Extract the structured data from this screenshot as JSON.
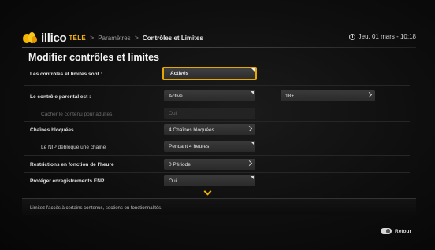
{
  "header": {
    "brand": "illico",
    "brand_sub": "TÉLÉ",
    "breadcrumb": [
      "Paramètres",
      "Contrôles et Limites"
    ],
    "separator": ">",
    "datetime": "Jeu. 01 mars - 10:18"
  },
  "page_title": "Modifier contrôles et limites",
  "rows": [
    {
      "label": "Les contrôles et limites sont :",
      "value": "Activés"
    },
    {
      "label": "Le contrôle parental est :",
      "value": "Activé",
      "extra_value": "18+"
    },
    {
      "label": "Cacher le contenu pour adultes",
      "value": "Oui"
    },
    {
      "label": "Chaînes bloquées",
      "value": "4 Chaînes bloquées"
    },
    {
      "label": "Le NIP débloque une chaîne",
      "value": "Pendant 4 heures"
    },
    {
      "label": "Restrictions en fonction de l'heure",
      "value": "0 Période"
    },
    {
      "label": "Protéger enregistrements ENP",
      "value": "Oui"
    }
  ],
  "hint": "Limitez l'accès à certains contenus, sections ou fonctionnalités.",
  "footer": {
    "back_label": "Retour"
  },
  "colors": {
    "accent": "#e6a800",
    "background": "#0e0e0e"
  }
}
